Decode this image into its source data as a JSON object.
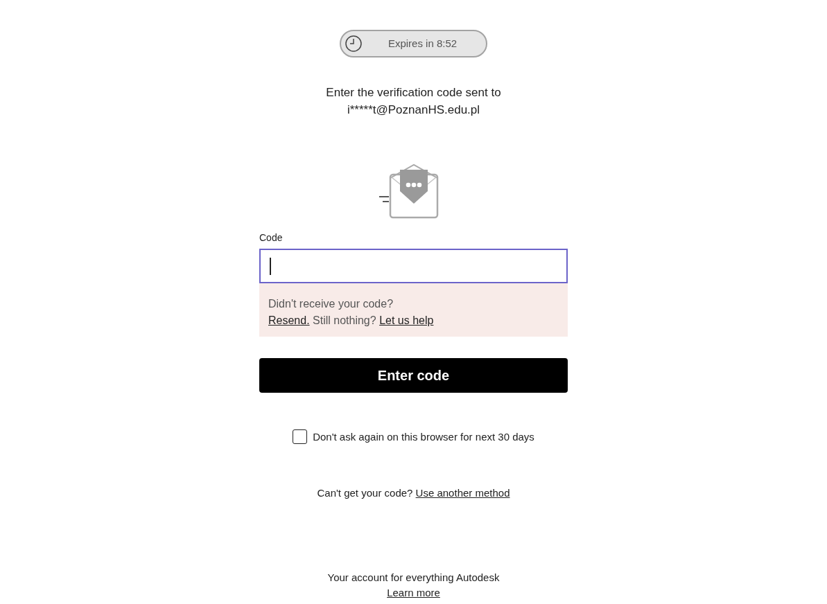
{
  "timer": {
    "text": "Expires in 8:52"
  },
  "prompt": {
    "lines": [
      "Enter the verification code sent to",
      "i*****t@PoznanHS.edu.pl"
    ]
  },
  "code_field": {
    "label": "Code",
    "focused": true
  },
  "help_box": {
    "question": "Didn't receive your code?",
    "resend_link": "Resend.",
    "middle": "Still nothing?",
    "help_link": "Let us help"
  },
  "submit_button": {
    "label": "Enter code"
  },
  "remember": {
    "label": "Don't ask again on this browser for next 30 days",
    "checked": false
  },
  "alt_method": {
    "text": "Can't get your code?",
    "link": "Use another method"
  },
  "footer": {
    "text": "Your account for everything Autodesk",
    "link": "Learn more"
  }
}
